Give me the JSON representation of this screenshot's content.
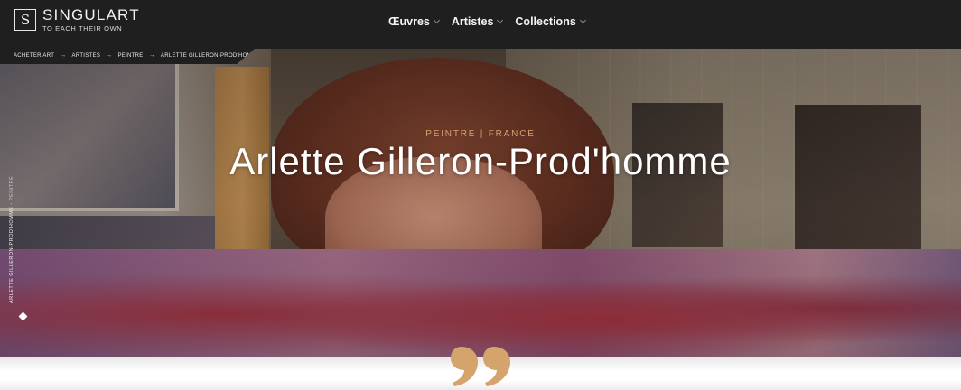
{
  "brand": {
    "name": "SINGULART",
    "tagline": "TO EACH THEIR OWN",
    "monogram": "S"
  },
  "nav": {
    "items": [
      {
        "label": "Œuvres"
      },
      {
        "label": "Artistes"
      },
      {
        "label": "Collections"
      }
    ]
  },
  "breadcrumb": {
    "items": [
      {
        "label": "ACHETER ART"
      },
      {
        "label": "ARTISTES"
      },
      {
        "label": "PEINTRE"
      },
      {
        "label": "ARLETTE GILLERON-PROD'HOMME"
      }
    ],
    "separator": "→"
  },
  "hero": {
    "subtitle": "PEINTRE | FRANCE",
    "title": "Arlette Gilleron-Prod'homme",
    "side_name": "ARLETTE GILLERON-PROD'HOMME",
    "side_role": "PEINTRE"
  },
  "colors": {
    "nav_bg": "#1f1f1f",
    "accent": "#d8a06e",
    "quote": "#d4a46c"
  },
  "icons": {
    "quote": "double-quote-icon",
    "marker": "diamond-icon",
    "logo": "singulart-logo-icon"
  }
}
